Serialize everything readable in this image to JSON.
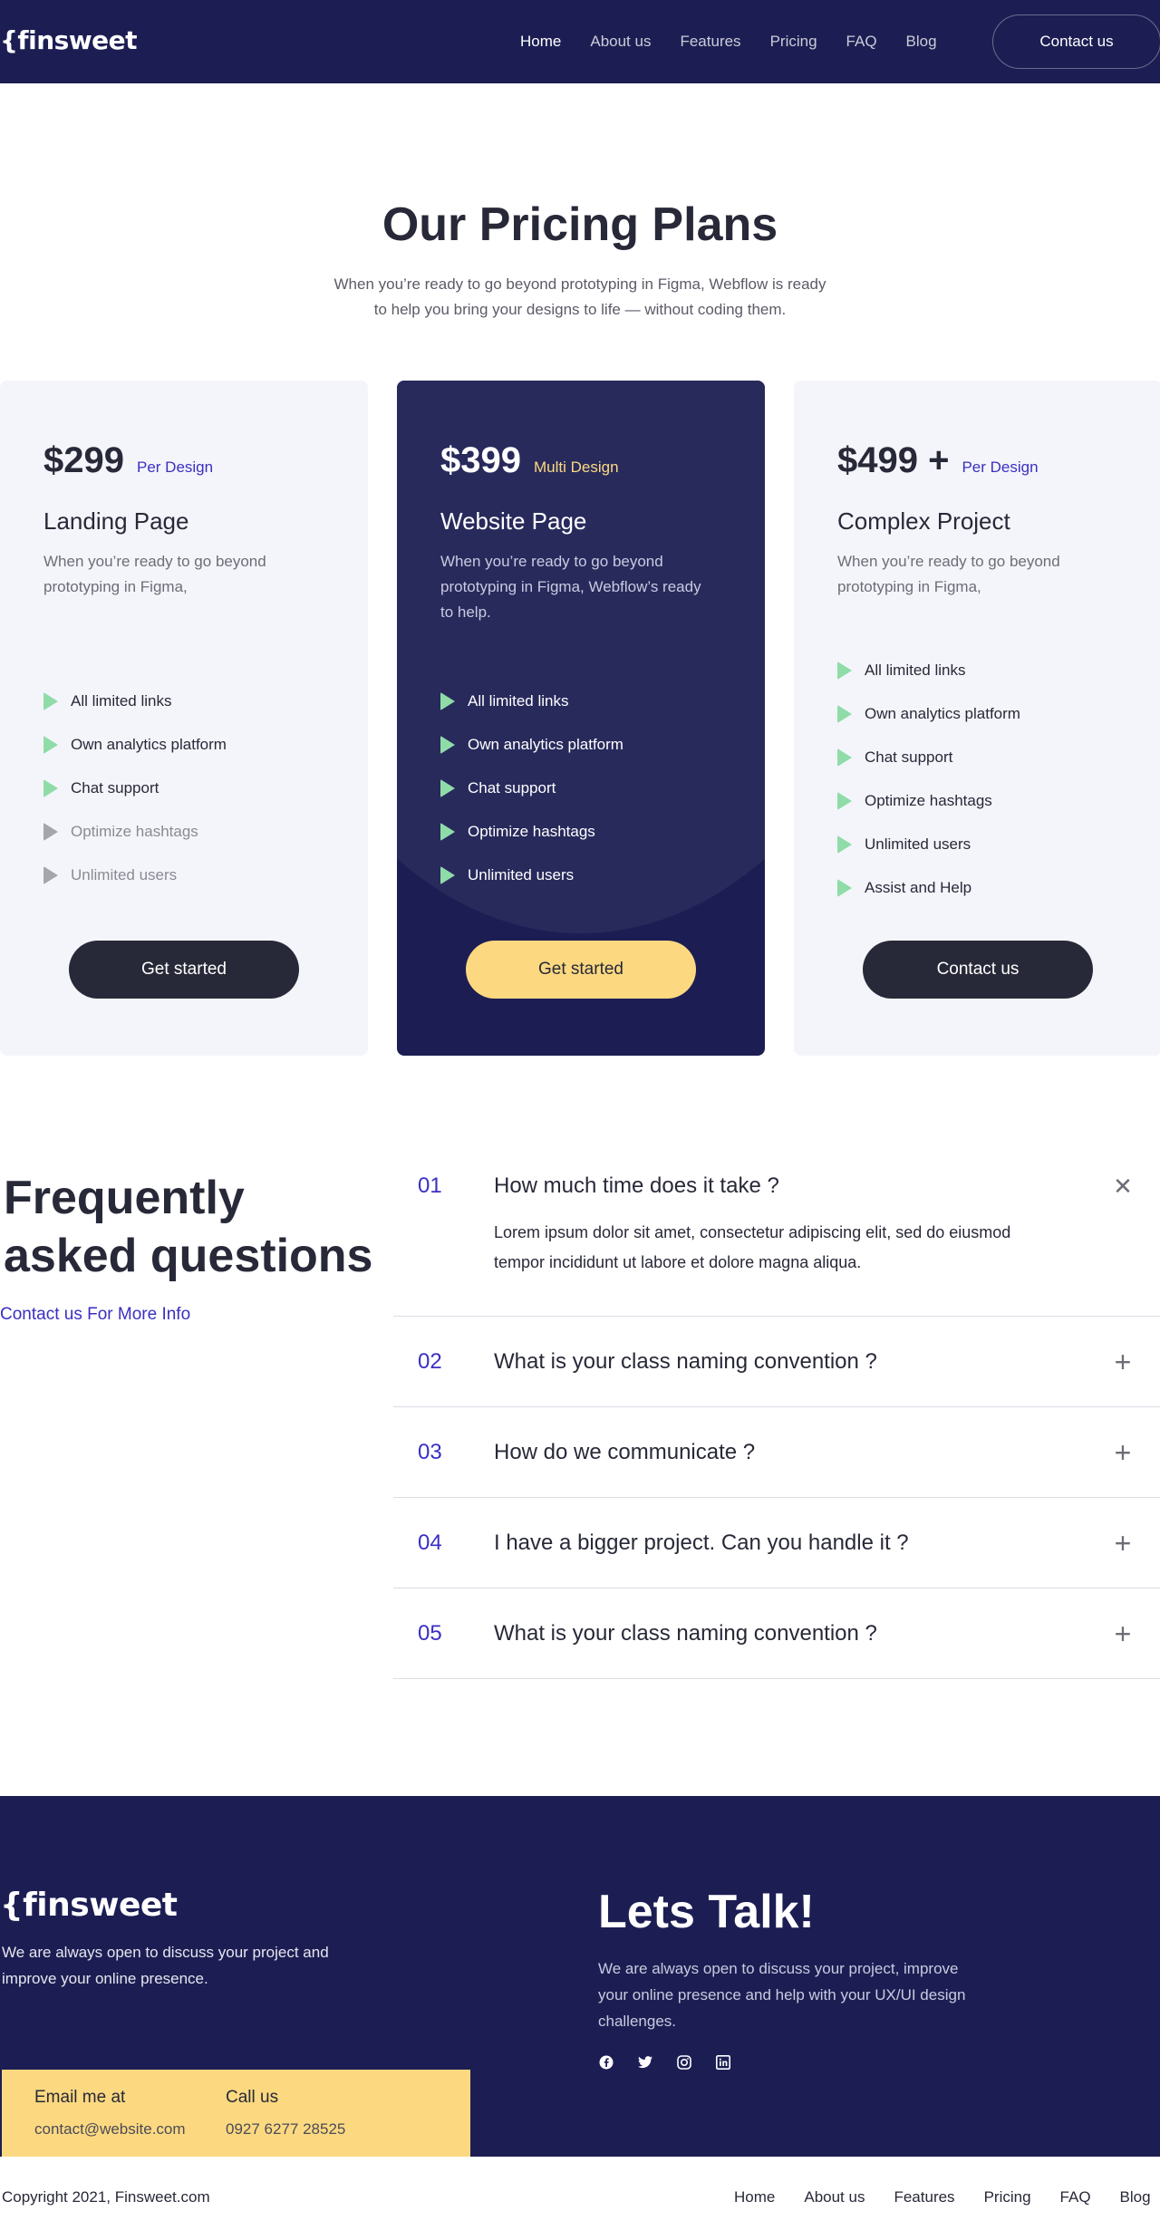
{
  "nav": {
    "logo": "{finsweet",
    "links": [
      "Home",
      "About us",
      "Features",
      "Pricing",
      "FAQ",
      "Blog"
    ],
    "active": "Home",
    "cta": "Contact us"
  },
  "pricing": {
    "title": "Our Pricing Plans",
    "subtitle": "When you’re ready to go beyond prototyping in Figma, Webflow is ready to help you bring your designs to life — without coding them.",
    "plans": [
      {
        "price": "$299",
        "unit": "Per Design",
        "name": "Landing Page",
        "description": "When you’re ready to go beyond prototyping in Figma,",
        "features": [
          {
            "label": "All limited links",
            "enabled": true
          },
          {
            "label": "Own analytics platform",
            "enabled": true
          },
          {
            "label": "Chat support",
            "enabled": true
          },
          {
            "label": "Optimize hashtags",
            "enabled": false
          },
          {
            "label": "Unlimited users",
            "enabled": false
          }
        ],
        "button": "Get started"
      },
      {
        "price": "$399",
        "unit": "Multi Design",
        "name": "Website Page",
        "description": "When you’re ready to go beyond prototyping in Figma, Webflow’s ready to help.",
        "features": [
          {
            "label": "All limited links",
            "enabled": true
          },
          {
            "label": "Own analytics platform",
            "enabled": true
          },
          {
            "label": "Chat support",
            "enabled": true
          },
          {
            "label": "Optimize hashtags",
            "enabled": true
          },
          {
            "label": "Unlimited users",
            "enabled": true
          }
        ],
        "button": "Get started"
      },
      {
        "price": "$499 +",
        "unit": "Per Design",
        "name": "Complex Project",
        "description": "When you’re ready to go beyond prototyping in Figma,",
        "features": [
          {
            "label": "All limited links",
            "enabled": true
          },
          {
            "label": "Own analytics platform",
            "enabled": true
          },
          {
            "label": "Chat support",
            "enabled": true
          },
          {
            "label": "Optimize hashtags",
            "enabled": true
          },
          {
            "label": "Unlimited users",
            "enabled": true
          },
          {
            "label": "Assist and Help",
            "enabled": true
          }
        ],
        "button": "Contact us"
      }
    ]
  },
  "faq": {
    "title": "Frequently asked questions",
    "link": "Contact us For More Info",
    "items": [
      {
        "num": "01",
        "question": "How much time does it take ?",
        "answer": "Lorem ipsum dolor sit amet, consectetur adipiscing elit, sed do eiusmod tempor incididunt ut labore et dolore magna aliqua.",
        "open": true
      },
      {
        "num": "02",
        "question": "What is your class naming convention ?",
        "open": false
      },
      {
        "num": "03",
        "question": "How do we communicate ?",
        "open": false
      },
      {
        "num": "04",
        "question": "I have a bigger project. Can you handle it ?",
        "open": false
      },
      {
        "num": "05",
        "question": "What is your class naming convention ?",
        "open": false
      }
    ]
  },
  "footer": {
    "logo": "{finsweet",
    "description": "We are always open to discuss your project and improve your online presence.",
    "talk_title": "Lets Talk!",
    "talk_description": "We are always open to discuss your project, improve your online presence and help with your UX/UI design challenges.",
    "socials": [
      "facebook-icon",
      "twitter-icon",
      "instagram-icon",
      "linkedin-icon"
    ],
    "email_label": "Email me at",
    "email": "contact@website.com",
    "call_label": "Call us",
    "phone": "0927 6277 28525",
    "copyright": "Copyright 2021, Finsweet.com",
    "links": [
      "Home",
      "About us",
      "Features",
      "Pricing",
      "FAQ",
      "Blog"
    ]
  },
  "colors": {
    "navy": "#1c1e53",
    "accent_yellow": "#fcd980",
    "accent_purple": "#3a2fc2",
    "check_green": "#8fdca8",
    "card_light": "#f4f5fa"
  }
}
